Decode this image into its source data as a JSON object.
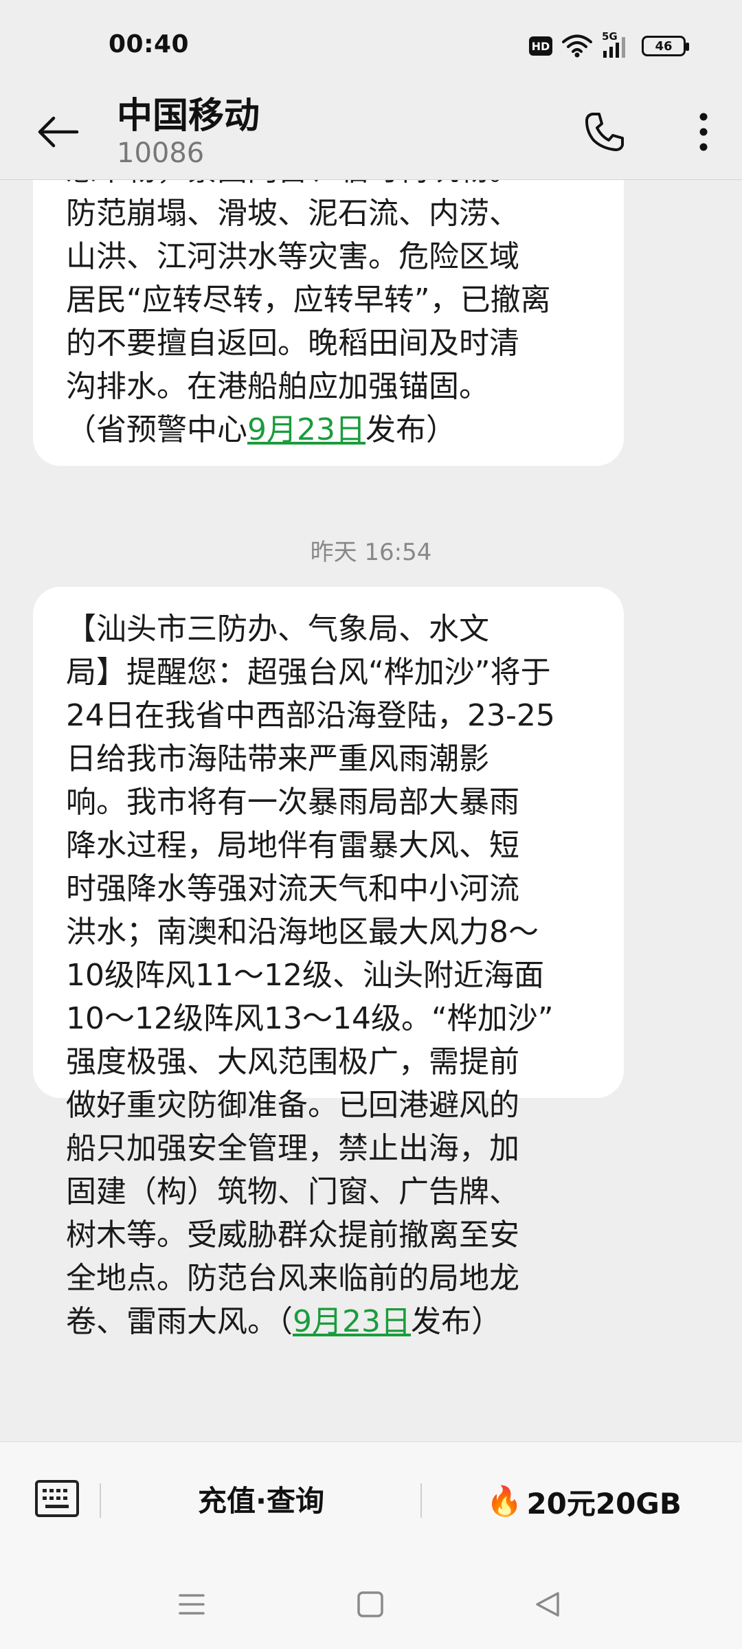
{
  "status_bar": {
    "time": "00:40",
    "network": "5G",
    "hd_label": "HD",
    "battery": "46"
  },
  "header": {
    "contact_name": "中国移动",
    "contact_number": "10086"
  },
  "messages": [
    {
      "text_before_link": "悬市物，紧固门窗、临时构筑物。\n防范崩塌、滑坡、泥石流、内涝、\n山洪、江河洪水等灾害。危险区域\n居民“应转尽转，应转早转”，已撤离\n的不要擅自返回。晚稻田间及时清\n沟排水。在港船舶应加强锚固。\n（省预警中心",
      "link_text": "9月23日",
      "text_after_link": "发布）"
    },
    {
      "text_before_link": "【汕头市三防办、气象局、水文\n局】提醒您：超强台风“桦加沙”将于\n24日在我省中西部沿海登陆，23-25\n日给我市海陆带来严重风雨潮影\n响。我市将有一次暴雨局部大暴雨\n降水过程，局地伴有雷暴大风、短\n时强降水等强对流天气和中小河流\n洪水；南澳和沿海地区最大风力8～\n10级阵风11～12级、汕头附近海面\n10～12级阵风13～14级。“桦加沙”\n强度极强、大风范围极广，需提前\n做好重灾防御准备。已回港避风的\n船只加强安全管理，禁止出海，加\n固建（构）筑物、门窗、广告牌、\n树木等。受威胁群众提前撤离至安\n全地点。防范台风来临前的局地龙\n卷、雷雨大风。（",
      "link_text": "9月23日",
      "text_after_link": "发布）"
    }
  ],
  "timestamp": "昨天 16:54",
  "bottom_menu": {
    "recharge_label": "充值·查询",
    "flame_icon": "🔥",
    "data_label": "20元20GB"
  }
}
